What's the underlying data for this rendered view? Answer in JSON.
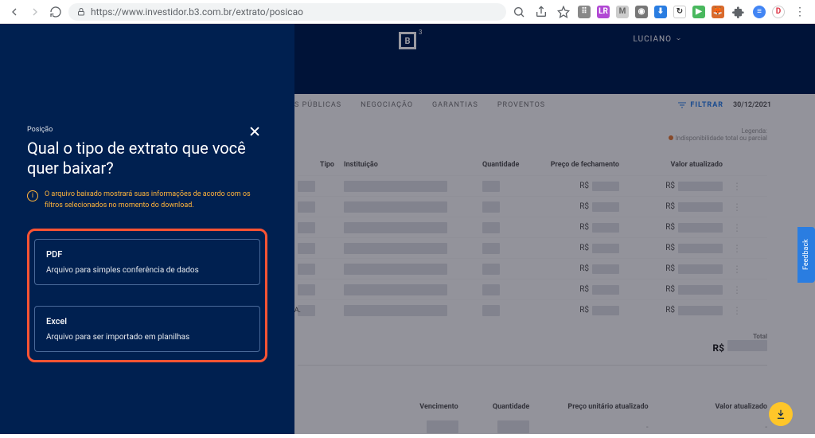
{
  "browser": {
    "url": "https://www.investidor.b3.com.br/extrato/posicao"
  },
  "header": {
    "logo_text": "B",
    "logo_exp": "3",
    "user_name": "LUCIANO"
  },
  "tabs": {
    "publicas": "S PÚBLICAS",
    "negociacao": "NEGOCIAÇÃO",
    "garantias": "GARANTIAS",
    "proventos": "PROVENTOS"
  },
  "filter": {
    "label": "FILTRAR",
    "date": "30/12/2021"
  },
  "legend": {
    "title": "Legenda:",
    "item1": "Indisponibilidade total ou parcial"
  },
  "table1": {
    "headers": {
      "tipo": "Tipo",
      "instituicao": "Instituição",
      "quantidade": "Quantidade",
      "preco": "Preço de fechamento",
      "valor": "Valor atualizado"
    },
    "currency": "R$",
    "sa_label": "S.A.",
    "total_label": "Total",
    "total_currency": "R$"
  },
  "table2": {
    "headers": {
      "vencimento": "Vencimento",
      "quantidade": "Quantidade",
      "preco_unit": "Preço unitário atualizado",
      "valor": "Valor atualizado"
    },
    "dash": "-"
  },
  "modal": {
    "breadcrumb": "Posição",
    "title": "Qual o tipo de extrato que você quer baixar?",
    "info": "O arquivo baixado mostrará suas informações de acordo com os filtros selecionados no momento do download.",
    "options": [
      {
        "title": "PDF",
        "desc": "Arquivo para simples conferência de dados"
      },
      {
        "title": "Excel",
        "desc": "Arquivo para ser importado em planilhas"
      }
    ]
  },
  "feedback_label": "Feedback"
}
